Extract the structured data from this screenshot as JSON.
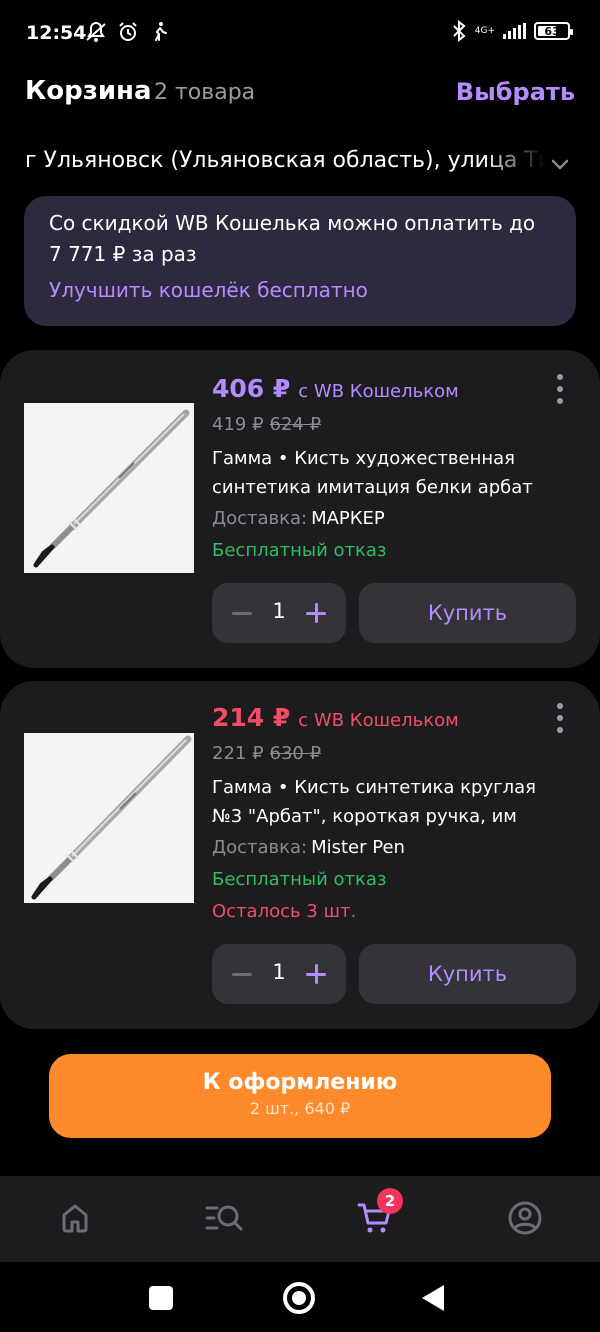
{
  "status_bar": {
    "time": "12:54",
    "network": "4G+",
    "battery": "63",
    "battery_level": 0.63,
    "icons": [
      "notifications-off-icon",
      "alarm-icon",
      "walking-icon",
      "bluetooth-icon",
      "signal-icon",
      "battery-icon"
    ]
  },
  "header": {
    "title": "Корзина",
    "count": "2 товара",
    "select_label": "Выбрать"
  },
  "address": {
    "text": "г Ульяновск (Ульяновская область), улица Тимирязева",
    "icon": "chevron-down-icon"
  },
  "promo": {
    "text": "Со скидкой WB Кошелька можно оплатить до 7 771 ₽ за раз",
    "link": "Улучшить кошелёк бесплатно"
  },
  "items": [
    {
      "price": "406 ₽",
      "wallet_label": "с WB Кошельком",
      "price_color": "#b58cff",
      "current_price": "419 ₽",
      "old_price": "624 ₽",
      "title": "Гамма • Кисть художественная синтетика имитация белки арбат",
      "delivery_label": "Доставка:",
      "seller": "МАРКЕР",
      "free_return": "Бесплатный отказ",
      "quantity": "1",
      "buy_label": "Купить"
    },
    {
      "price": "214 ₽",
      "wallet_label": "с WB Кошельком",
      "price_color": "#f24d67",
      "current_price": "221 ₽",
      "old_price": "630 ₽",
      "title": "Гамма • Кисть синтетика круглая №3 \"Арбат\", короткая ручка, им",
      "delivery_label": "Доставка:",
      "seller": "Mister Pen",
      "free_return": "Бесплатный отказ",
      "stock_left": "Осталось 3 шт.",
      "quantity": "1",
      "buy_label": "Купить"
    }
  ],
  "checkout": {
    "label": "К оформлению",
    "summary": "2 шт., 640 ₽"
  },
  "tabbar": {
    "tabs": [
      "home-icon",
      "catalog-search-icon",
      "cart-icon",
      "profile-icon"
    ],
    "active": "cart-icon",
    "cart_badge": "2"
  },
  "colors": {
    "accent": "#b58cff",
    "checkout": "#ff8a2b",
    "success": "#2dbf60",
    "danger": "#f24d67",
    "card": "#1c1c1f"
  }
}
